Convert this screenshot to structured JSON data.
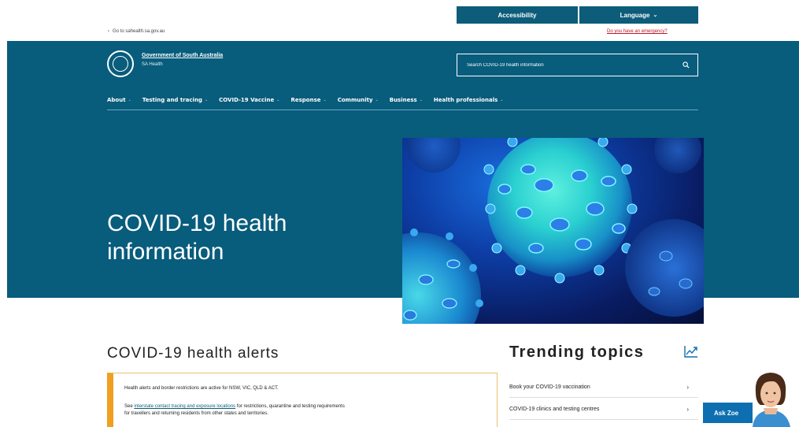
{
  "utility": {
    "accessibility": "Accessibility",
    "language": "Language",
    "back_link": "Go to sahealth.sa.gov.au",
    "emergency": "Do you have an emergency?"
  },
  "header": {
    "gov_name": "Government of South Australia",
    "gov_sub": "SA Health",
    "search_placeholder": "Search COVID-19 health information",
    "search_icon": "search-icon"
  },
  "nav": {
    "items": [
      "About",
      "Testing and tracing",
      "COVID-19 Vaccine",
      "Response",
      "Community",
      "Business",
      "Health professionals"
    ]
  },
  "hero": {
    "title": "COVID-19 health information"
  },
  "alerts": {
    "title": "COVID-19 health alerts",
    "line1": "Health alerts and border restrictions are active for NSW, VIC, QLD & ACT.",
    "line2_pre": "See",
    "line2_link": "interstate contact tracing and exposure locations",
    "line2_post": "for restrictions, quarantine and testing requirements",
    "line3": "for travellers and returning residents from other states and territories."
  },
  "trending": {
    "title": "Trending topics",
    "items": [
      "Book your COVID-19 vaccination",
      "COVID-19 clinics and testing centres",
      ""
    ]
  },
  "assistant": {
    "label": "Ask Zoe"
  },
  "colors": {
    "brand": "#085c7c",
    "alert_accent": "#f0a020",
    "emergency": "#c0152b",
    "assistant": "#0d6fb0"
  }
}
